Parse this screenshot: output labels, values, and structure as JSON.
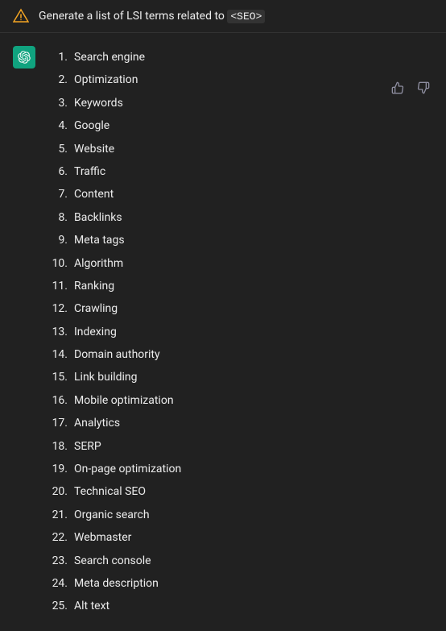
{
  "header": {
    "icon_alt": "warning-triangle-icon",
    "prompt_prefix": "Generate a list of LSI terms related to ",
    "prompt_tag": "<SEO>"
  },
  "message": {
    "avatar_alt": "chatgpt-logo",
    "list_items": [
      {
        "number": "1.",
        "text": "Search engine"
      },
      {
        "number": "2.",
        "text": "Optimization"
      },
      {
        "number": "3.",
        "text": "Keywords"
      },
      {
        "number": "4.",
        "text": "Google"
      },
      {
        "number": "5.",
        "text": "Website"
      },
      {
        "number": "6.",
        "text": "Traffic"
      },
      {
        "number": "7.",
        "text": "Content"
      },
      {
        "number": "8.",
        "text": "Backlinks"
      },
      {
        "number": "9.",
        "text": "Meta tags"
      },
      {
        "number": "10.",
        "text": "Algorithm"
      },
      {
        "number": "11.",
        "text": "Ranking"
      },
      {
        "number": "12.",
        "text": "Crawling"
      },
      {
        "number": "13.",
        "text": "Indexing"
      },
      {
        "number": "14.",
        "text": "Domain authority"
      },
      {
        "number": "15.",
        "text": "Link building"
      },
      {
        "number": "16.",
        "text": "Mobile optimization"
      },
      {
        "number": "17.",
        "text": "Analytics"
      },
      {
        "number": "18.",
        "text": "SERP"
      },
      {
        "number": "19.",
        "text": "On-page optimization"
      },
      {
        "number": "20.",
        "text": "Technical SEO"
      },
      {
        "number": "21.",
        "text": "Organic search"
      },
      {
        "number": "22.",
        "text": "Webmaster"
      },
      {
        "number": "23.",
        "text": "Search console"
      },
      {
        "number": "24.",
        "text": "Meta description"
      },
      {
        "number": "25.",
        "text": "Alt text"
      }
    ]
  },
  "actions": {
    "thumbs_up_label": "thumbs up",
    "thumbs_down_label": "thumbs down"
  },
  "colors": {
    "background": "#212121",
    "text": "#ececec",
    "muted": "#8e8ea0",
    "avatar_bg": "#10a37f",
    "header_border": "#333"
  }
}
